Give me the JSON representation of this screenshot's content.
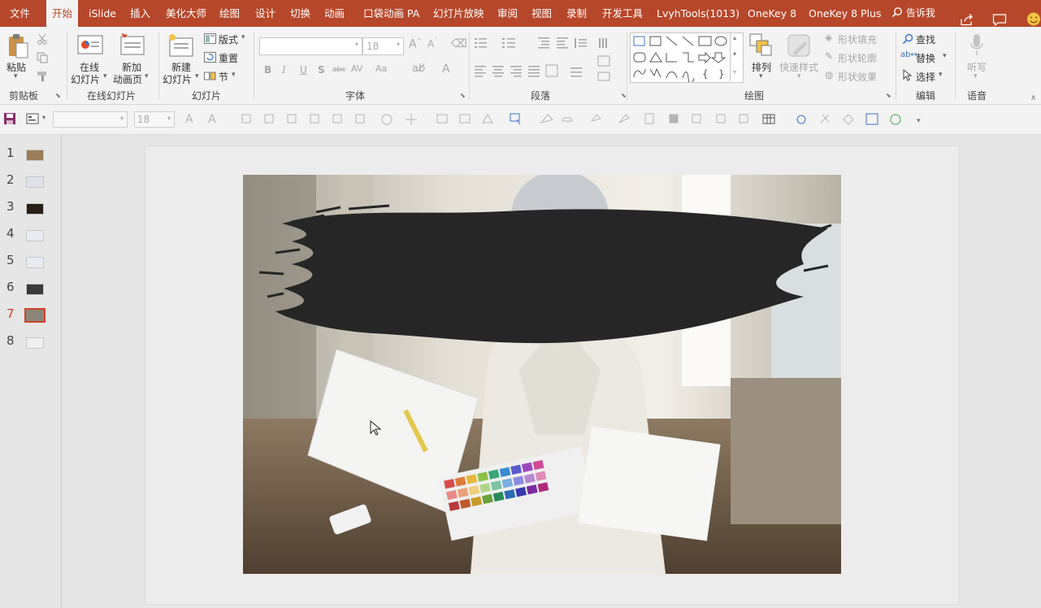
{
  "menu": {
    "file": "文件",
    "tabs": [
      "开始",
      "iSlide",
      "插入",
      "美化大师",
      "绘图",
      "设计",
      "切换",
      "动画",
      "口袋动画 PA",
      "幻灯片放映",
      "审阅",
      "视图",
      "录制",
      "开发工具",
      "LvyhTools(1013)",
      "OneKey 8",
      "OneKey 8 Plus"
    ],
    "tell_me": "告诉我"
  },
  "ribbon": {
    "clipboard": {
      "paste": "粘贴",
      "label": "剪贴板"
    },
    "online_slides": {
      "online": "在线",
      "online2": "幻灯片",
      "new_anim": "新加",
      "new_anim2": "动画页",
      "label": "在线幻灯片"
    },
    "slides": {
      "new": "新建",
      "new2": "幻灯片",
      "layout": "版式",
      "reset": "重置",
      "section": "节",
      "label": "幻灯片"
    },
    "font": {
      "size": "18",
      "label": "字体"
    },
    "paragraph": {
      "label": "段落"
    },
    "drawing": {
      "arrange": "排列",
      "quick_style": "快速样式",
      "shape_fill": "形状填充",
      "shape_outline": "形状轮廓",
      "shape_effect": "形状效果",
      "label": "绘图"
    },
    "editing": {
      "find": "查找",
      "replace": "替换",
      "select": "选择",
      "label": "编辑"
    },
    "voice": {
      "dictate": "听写",
      "label": "语音"
    }
  },
  "qat": {
    "font_size": "18"
  },
  "slides": {
    "numbers": [
      "1",
      "2",
      "3",
      "4",
      "5",
      "6",
      "7",
      "8"
    ],
    "current_index": 7
  },
  "colors": {
    "accent": "#b7472a",
    "current_slide": "#d0442a"
  }
}
